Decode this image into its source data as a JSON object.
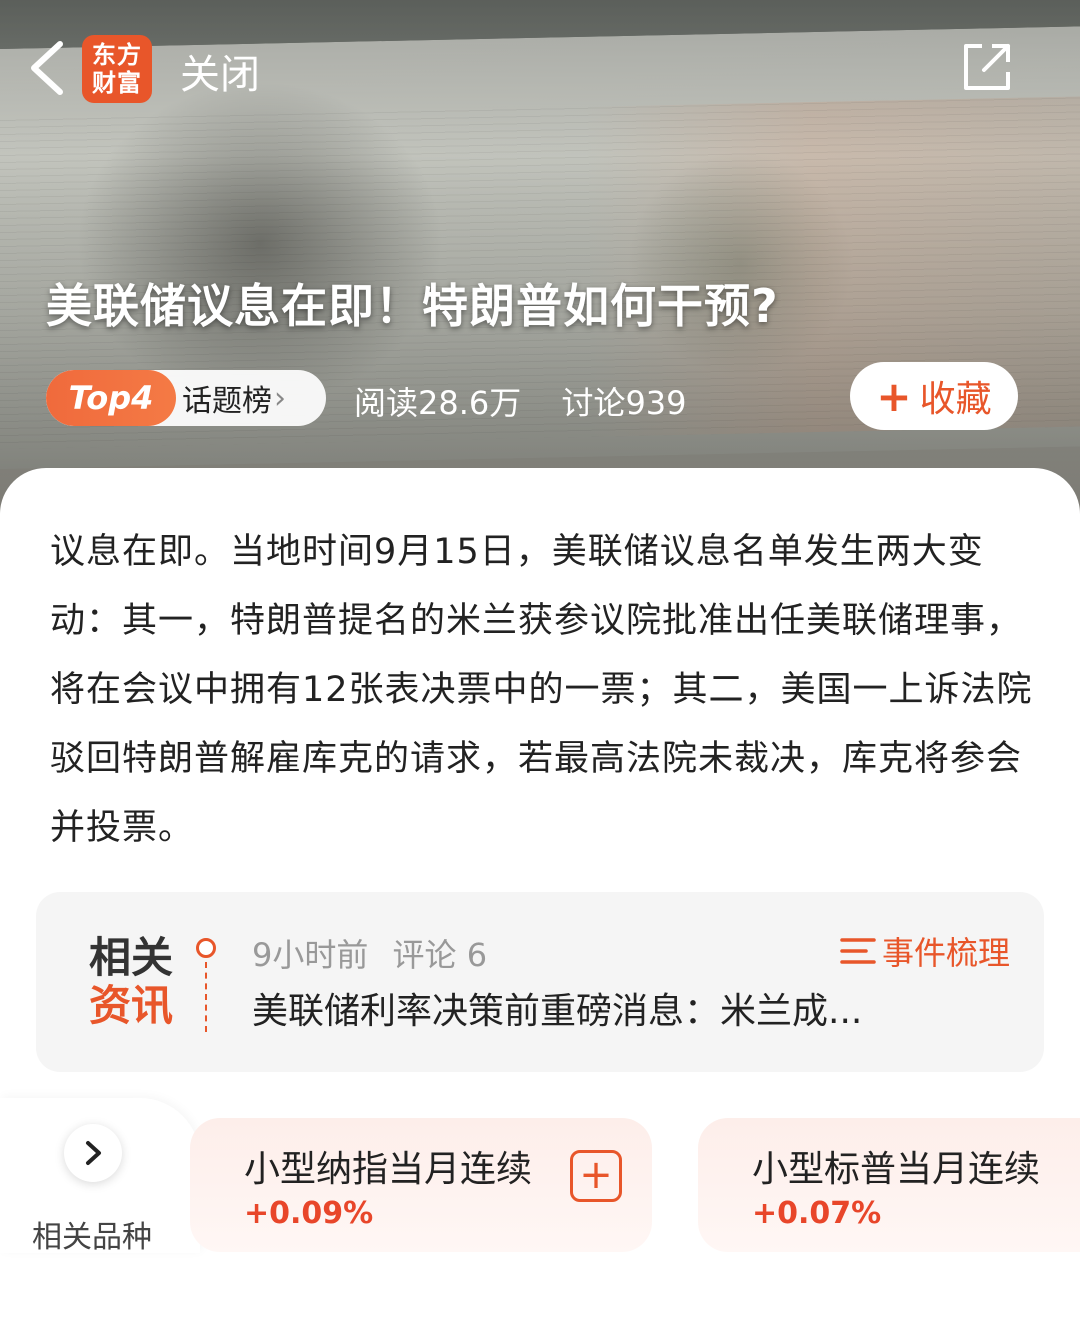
{
  "header": {
    "logo_line1": "东方",
    "logo_line2": "财富",
    "close_label": "关闭"
  },
  "topic": {
    "title": "美联储议息在即！特朗普如何干预?",
    "rank_badge": "Top4",
    "rank_label": "话题榜",
    "reads": "阅读28.6万",
    "discussions": "讨论939",
    "favorite_label": "收藏"
  },
  "summary": "议息在即。当地时间9月15日，美联储议息名单发生两大变动：其一，特朗普提名的米兰获参议院批准出任美联储理事，将在会议中拥有12张表决票中的一票；其二，美国一上诉法院驳回特朗普解雇库克的请求，若最高法院未裁决，库克将参会并投票。",
  "related_news": {
    "badge_line1": "相关",
    "badge_line2": "资讯",
    "time": "9小时前",
    "comments": "评论 6",
    "title": "美联储利率决策前重磅消息：米兰成...",
    "event_link": "事件梳理"
  },
  "related_instruments": {
    "label": "相关品种",
    "items": [
      {
        "name": "小型纳指当月连续",
        "change": "+0.09%"
      },
      {
        "name": "小型标普当月连续",
        "change": "+0.07%"
      }
    ]
  },
  "colors": {
    "accent": "#e8562a",
    "up": "#e8462a"
  }
}
